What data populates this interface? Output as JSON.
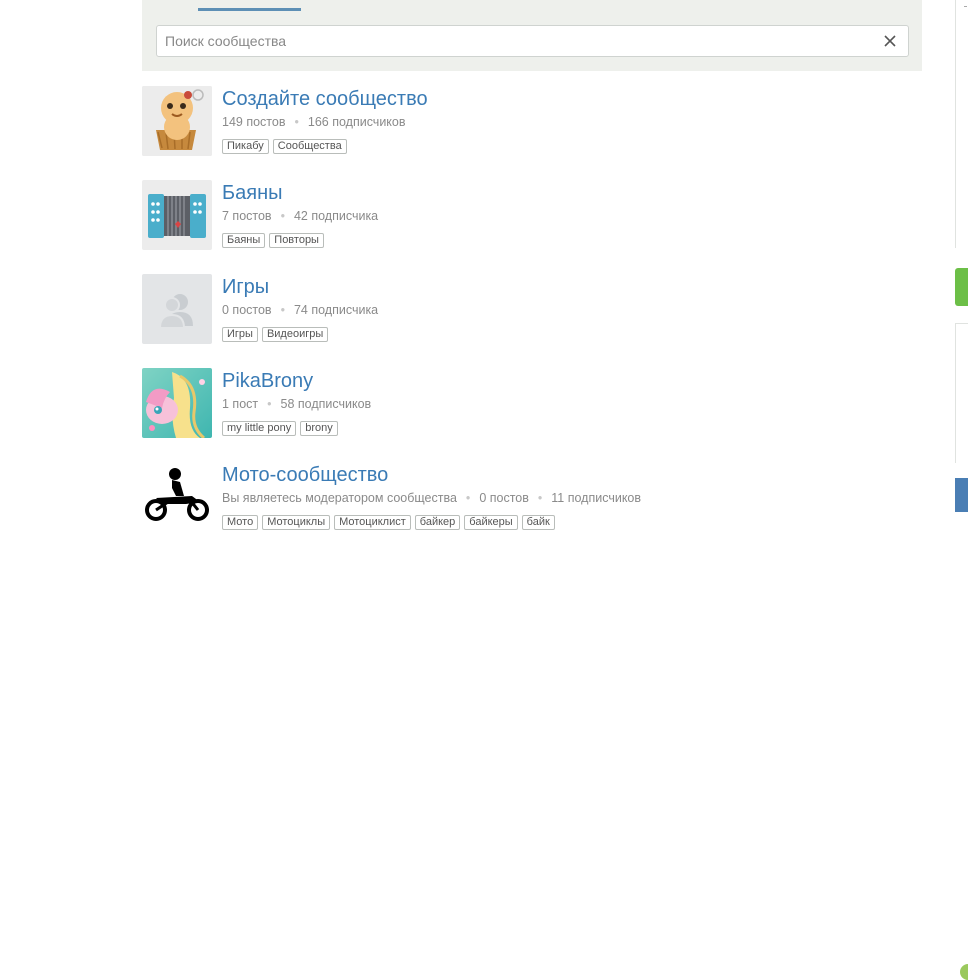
{
  "search": {
    "placeholder": "Поиск сообщества"
  },
  "communities": [
    {
      "name": "Создайте сообщество",
      "moderator_text": "",
      "posts": "149 постов",
      "subscribers": "166 подписчиков",
      "tags": [
        "Пикабу",
        "Сообщества"
      ],
      "avatar": "cupcake-mascot"
    },
    {
      "name": "Баяны",
      "moderator_text": "",
      "posts": "7 постов",
      "subscribers": "42 подписчика",
      "tags": [
        "Баяны",
        "Повторы"
      ],
      "avatar": "accordion"
    },
    {
      "name": "Игры",
      "moderator_text": "",
      "posts": "0 постов",
      "subscribers": "74 подписчика",
      "tags": [
        "Игры",
        "Видеоигры"
      ],
      "avatar": "users-placeholder"
    },
    {
      "name": "PikaBrony",
      "moderator_text": "",
      "posts": "1 пост",
      "subscribers": "58 подписчиков",
      "tags": [
        "my little pony",
        "brony"
      ],
      "avatar": "pony-art"
    },
    {
      "name": "Мото-сообщество",
      "moderator_text": "Вы являетесь модератором сообщества",
      "posts": "0 постов",
      "subscribers": "11 подписчиков",
      "tags": [
        "Мото",
        "Мотоциклы",
        "Мотоциклист",
        "байкер",
        "байкеры",
        "байк"
      ],
      "avatar": "motorcycle"
    }
  ],
  "colors": {
    "link": "#3a7bb5",
    "muted": "#8a8a8a",
    "search_bg": "#eef0ec",
    "accent_green": "#6cbf47",
    "accent_blue": "#4a7eb4"
  }
}
